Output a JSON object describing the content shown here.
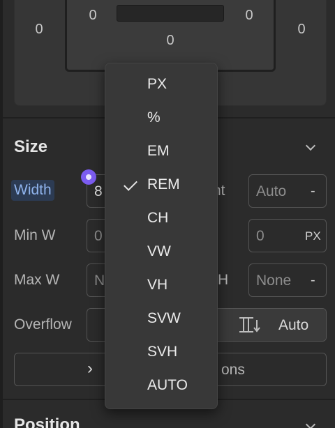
{
  "spacing": {
    "margin_left": "0",
    "padding_left": "0",
    "padding_right": "0",
    "margin_right": "0",
    "padding_top": "0",
    "padding_bottom": "0"
  },
  "size": {
    "title": "Size",
    "width_label": "Width",
    "width_value": "8",
    "height_label_partial": "nt",
    "height_value": "Auto",
    "height_dash": "-",
    "min_w_label": "Min W",
    "min_w_value": "0",
    "min_h_value": "0",
    "min_h_unit": "PX",
    "max_w_label": "Max W",
    "max_w_value": "N",
    "max_h_label_partial": "H",
    "max_h_value": "None",
    "max_h_dash": "-",
    "overflow_label": "Overflow",
    "overflow_value": "Auto",
    "more_options_partial": "ons",
    "more_chevron": "›"
  },
  "position": {
    "title": "Position"
  },
  "unit_menu": {
    "options": [
      "PX",
      "%",
      "EM",
      "REM",
      "CH",
      "VW",
      "VH",
      "SVW",
      "SVH",
      "AUTO"
    ],
    "selected": "REM"
  },
  "colors": {
    "accent": "#7b5cf0",
    "active_label_bg": "#2c3b53",
    "active_label_text": "#8fb3ec"
  }
}
